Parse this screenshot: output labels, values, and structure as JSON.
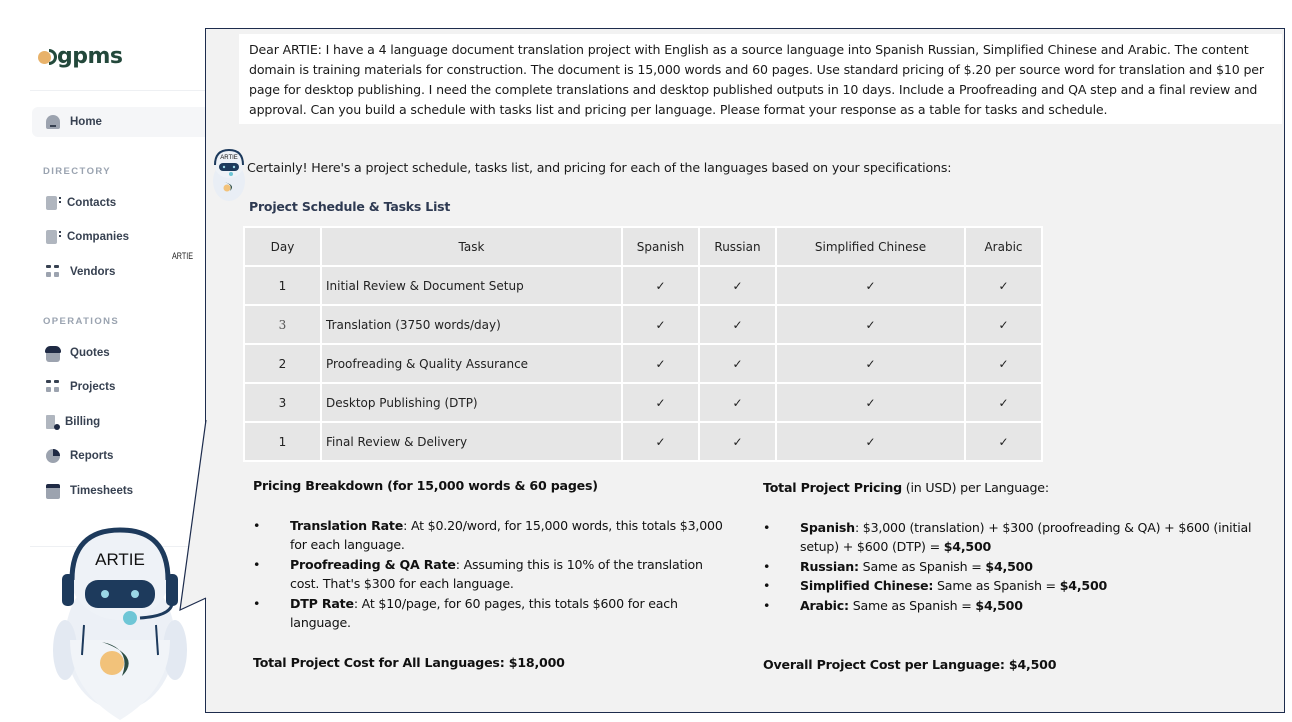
{
  "sidebar": {
    "logo_text": "gpms",
    "home_label": "Home",
    "directory_label": "DIRECTORY",
    "directory_items": [
      {
        "label": "Contacts",
        "icon": "contact-card-icon"
      },
      {
        "label": "Companies",
        "icon": "company-card-icon"
      },
      {
        "label": "Vendors",
        "icon": "grid-icon"
      }
    ],
    "operations_label": "OPERATIONS",
    "operations_items": [
      {
        "label": "Quotes",
        "icon": "briefcase-icon"
      },
      {
        "label": "Projects",
        "icon": "grid-icon"
      },
      {
        "label": "Billing",
        "icon": "billing-icon"
      },
      {
        "label": "Reports",
        "icon": "pie-chart-icon"
      },
      {
        "label": "Timesheets",
        "icon": "calendar-icon"
      }
    ],
    "artie_label": "ARTIE",
    "robot_label": "ARTIE"
  },
  "chat": {
    "user_message": "Dear ARTIE:  I have a 4 language document translation project with English as a source language into Spanish Russian, Simplified Chinese and Arabic.  The content domain is training materials for construction. The document is 15,000 words and 60 pages.  Use standard pricing of $.20 per source word for translation and $10 per page for desktop publishing.  I need the complete translations and desktop published outputs in 10 days.  Include a Proofreading and QA step and a final review and approval. Can you build a schedule with tasks list and pricing per language. Please format your response as a table for tasks and schedule.",
    "avatar_label": "ARTIE",
    "ai_intro": "Certainly! Here's a project schedule, tasks list, and pricing for each of the languages based on your specifications:",
    "schedule_title": "Project Schedule & Tasks List",
    "table": {
      "headers": [
        "Day",
        "Task",
        "Spanish",
        "Russian",
        "Simplified Chinese",
        "Arabic"
      ],
      "rows": [
        {
          "day": "1",
          "task": "Initial Review & Document Setup",
          "marks": [
            "✓",
            "✓",
            "✓",
            "✓"
          ]
        },
        {
          "day": "3",
          "task": "Translation (3750 words/day)",
          "marks": [
            "✓",
            "✓",
            "✓",
            "✓"
          ]
        },
        {
          "day": "2",
          "task": "Proofreading & Quality Assurance",
          "marks": [
            "✓",
            "✓",
            "✓",
            "✓"
          ]
        },
        {
          "day": "3",
          "task": "Desktop Publishing (DTP)",
          "marks": [
            "✓",
            "✓",
            "✓",
            "✓"
          ]
        },
        {
          "day": "1",
          "task": "Final Review & Delivery",
          "marks": [
            "✓",
            "✓",
            "✓",
            "✓"
          ]
        }
      ]
    },
    "pricing": {
      "title": "Pricing Breakdown (for 15,000 words & 60 pages)",
      "items": [
        {
          "label": "Translation Rate",
          "text": ": At $0.20/word, for 15,000 words, this totals $3,000 for each language."
        },
        {
          "label": "Proofreading & QA Rate",
          "text": ": Assuming this is 10% of the translation cost. That's $300 for each language."
        },
        {
          "label": "DTP Rate",
          "text": ": At $10/page, for 60 pages, this totals $600 for each language."
        }
      ],
      "total_label": "Total Project Cost for All Languages: ",
      "total_value": "$18,000"
    },
    "totals": {
      "title_bold": "Total Project Pricing",
      "title_rest": " (in USD) per Language:",
      "items": [
        {
          "label": "Spanish",
          "text": ": $3,000 (translation) + $300 (proofreading & QA) + $600 (initial setup) + $600 (DTP) = ",
          "value": "$4,500"
        },
        {
          "label": "Russian:",
          "text": " Same as Spanish = ",
          "value": "$4,500"
        },
        {
          "label": "Simplified Chinese:",
          "text": " Same as Spanish = ",
          "value": "$4,500"
        },
        {
          "label": "Arabic:",
          "text": " Same as Spanish = ",
          "value": "$4,500"
        }
      ],
      "overall_label": "Overall Project Cost per Language: ",
      "overall_value": "$4,500"
    }
  }
}
